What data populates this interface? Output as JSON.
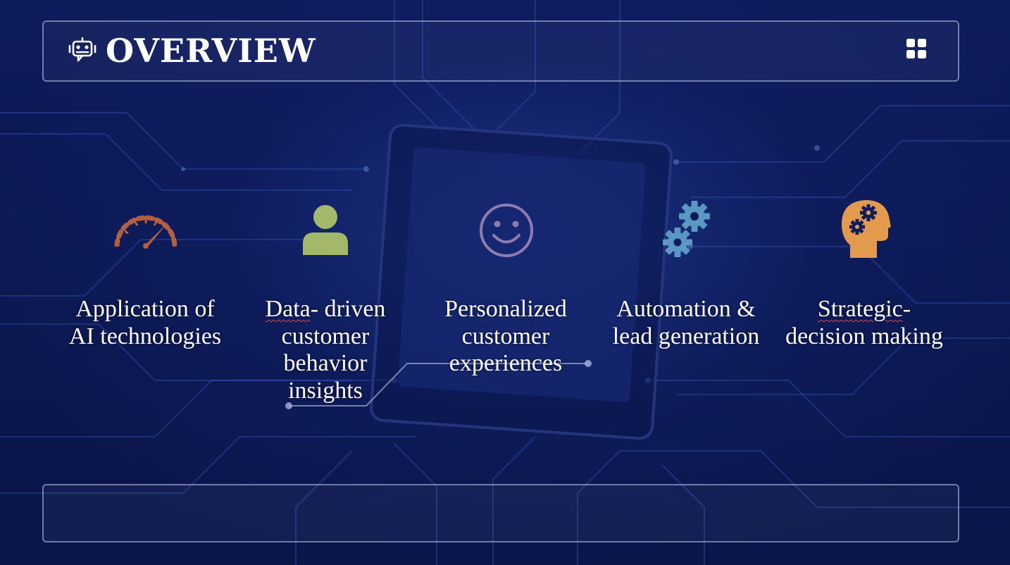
{
  "slide": {
    "title": "OVERVIEW",
    "header_icon": "robot-icon",
    "menu_icon": "grid-icon"
  },
  "features": [
    {
      "id": "application",
      "label": "Application of AI technologies",
      "icon": "speedometer-icon",
      "color": "#b2603f"
    },
    {
      "id": "data",
      "label_main": "Data",
      "label_rest": "- driven customer behavior insights",
      "icon": "person-icon",
      "color": "#a4b86a"
    },
    {
      "id": "personalized",
      "label": "Personalized customer experiences",
      "icon": "smiley-icon",
      "color": "#8c7cb2"
    },
    {
      "id": "automation",
      "label": "Automation & lead generation",
      "icon": "gears-icon",
      "color": "#5a97c2"
    },
    {
      "id": "strategic",
      "label_main": "Strategic",
      "label_rest": "- decision making",
      "icon": "head-gears-icon",
      "color": "#e39a4d"
    }
  ],
  "colors": {
    "background": "#0d1a57",
    "accent_circuit": "#3f63c9",
    "text": "#ffffff"
  }
}
